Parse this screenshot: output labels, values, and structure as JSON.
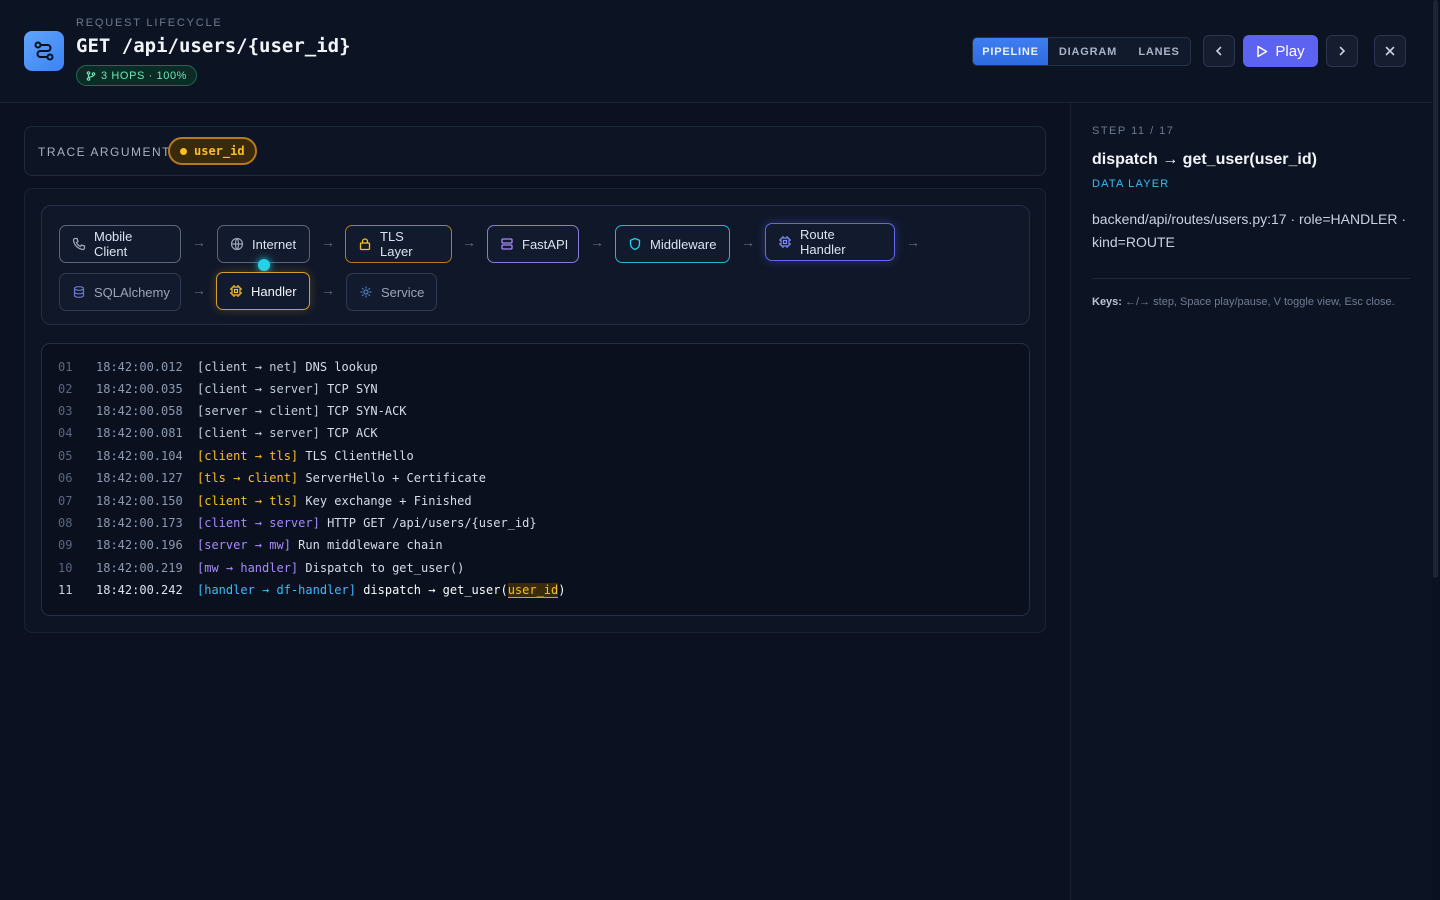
{
  "header": {
    "eyebrow": "REQUEST LIFECYCLE",
    "title": "GET /api/users/{user_id}",
    "hops_badge": "3 HOPS · 100%",
    "views": [
      {
        "label": "PIPELINE",
        "active": true
      },
      {
        "label": "DIAGRAM",
        "active": false
      },
      {
        "label": "LANES",
        "active": false
      }
    ],
    "play_label": "Play"
  },
  "trace": {
    "label": "TRACE ARGUMENT:",
    "argument": "user_id"
  },
  "pipeline": {
    "row1": [
      {
        "label": "Mobile Client",
        "icon": "phone-icon"
      },
      {
        "label": "Internet",
        "icon": "globe-icon"
      },
      {
        "label": "TLS Layer",
        "icon": "lock-icon"
      },
      {
        "label": "FastAPI",
        "icon": "server-icon"
      },
      {
        "label": "Middleware",
        "icon": "shield-icon"
      },
      {
        "label": "Route Handler",
        "icon": "cpu-icon"
      }
    ],
    "row2": [
      {
        "label": "SQLAlchemy",
        "icon": "database-icon"
      },
      {
        "label": "Handler",
        "icon": "cpu-icon"
      },
      {
        "label": "Service",
        "icon": "cog-icon"
      }
    ]
  },
  "log": [
    {
      "num": "01",
      "ts": "18:42:00.012",
      "tag": "[client → net]",
      "msg": "DNS lookup"
    },
    {
      "num": "02",
      "ts": "18:42:00.035",
      "tag": "[client → server]",
      "msg": "TCP SYN"
    },
    {
      "num": "03",
      "ts": "18:42:00.058",
      "tag": "[server → client]",
      "msg": "TCP SYN-ACK"
    },
    {
      "num": "04",
      "ts": "18:42:00.081",
      "tag": "[client → server]",
      "msg": "TCP ACK"
    },
    {
      "num": "05",
      "ts": "18:42:00.104",
      "tag": "[client → tls]",
      "msg": "TLS ClientHello"
    },
    {
      "num": "06",
      "ts": "18:42:00.127",
      "tag": "[tls → client]",
      "msg": "ServerHello + Certificate"
    },
    {
      "num": "07",
      "ts": "18:42:00.150",
      "tag": "[client → tls]",
      "msg": "Key exchange + Finished"
    },
    {
      "num": "08",
      "ts": "18:42:00.173",
      "tag": "[client → server]",
      "msg": "HTTP GET /api/users/{user_id}"
    },
    {
      "num": "09",
      "ts": "18:42:00.196",
      "tag": "[server → mw]",
      "msg": "Run middleware chain"
    },
    {
      "num": "10",
      "ts": "18:42:00.219",
      "tag": "[mw → handler]",
      "msg": "Dispatch to get_user()"
    },
    {
      "num": "11",
      "ts": "18:42:00.242",
      "tag": "[handler → df-handler]",
      "msg_pre": "dispatch → get_user(",
      "msg_arg": "user_id",
      "msg_post": ")"
    }
  ],
  "panel": {
    "step": "STEP 11 / 17",
    "title": "dispatch → get_user(user_id)",
    "layer": "DATA LAYER",
    "detail": "backend/api/routes/users.py:17 · role=HANDLER · kind=ROUTE",
    "keys_label": "Keys:",
    "keys_text": "←/→ step, Space play/pause, V toggle view, Esc close."
  },
  "colors": {
    "accent": "#3b82f6",
    "play": "#5b63f0",
    "tls": "#fbbf24",
    "middleware": "#22d3ee",
    "fastapi": "#a78bfa",
    "route": "#6366f1"
  }
}
